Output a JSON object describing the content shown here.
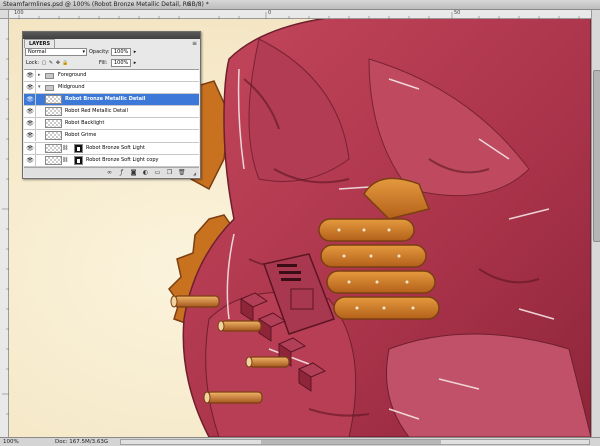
{
  "document_tab": {
    "title": "Steamfarmlines.psd @ 100% (Robot Bronze Metallic Detail, RGB/8) *",
    "close_glyph": "×"
  },
  "ruler_top_numbers": [
    "0",
    "50",
    "100"
  ],
  "layers_panel": {
    "tab_label": "LAYERS",
    "blend_mode": "Normal",
    "opacity_label": "Opacity:",
    "opacity_value": "100%",
    "lock_label": "Lock:",
    "fill_label": "Fill:",
    "fill_value": "100%",
    "layers": [
      {
        "name": "Foreground",
        "kind": "group",
        "selected": false
      },
      {
        "name": "Midground",
        "kind": "group-open",
        "selected": false
      },
      {
        "name": "Robot Bronze Metallic Detail",
        "kind": "layer",
        "selected": true
      },
      {
        "name": "Robot Red Metallic Detail",
        "kind": "layer",
        "selected": false
      },
      {
        "name": "Robot Backlight",
        "kind": "layer",
        "selected": false
      },
      {
        "name": "Robot Grime",
        "kind": "layer",
        "selected": false
      },
      {
        "name": "Robot Bronze Soft Light",
        "kind": "adjustment",
        "selected": false
      },
      {
        "name": "Robot Bronze Soft Light copy",
        "kind": "adjustment",
        "selected": false
      }
    ],
    "footer_icons": [
      "link-icon",
      "fx-icon",
      "mask-icon",
      "adjustment-icon",
      "group-icon",
      "new-layer-icon",
      "trash-icon"
    ]
  },
  "status_bar": {
    "zoom": "100%",
    "doc_size": "Doc: 167.5M/3.63G"
  },
  "colors": {
    "selection": "#3b78d8",
    "robot_red": "#b23a4e",
    "bronze": "#c9731c",
    "background_cream": "#f6ecd0"
  }
}
